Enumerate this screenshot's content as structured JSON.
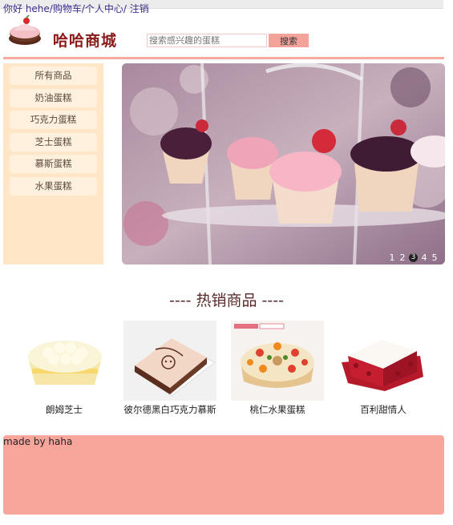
{
  "topnav": {
    "greeting": "你好 hehe",
    "cart": "购物车",
    "profile": "个人中心",
    "logout": "注销"
  },
  "brand": {
    "logo_text": "哈哈商城"
  },
  "search": {
    "placeholder": "搜索感兴趣的蛋糕",
    "button": "搜索"
  },
  "sidebar": {
    "items": [
      {
        "label": "所有商品"
      },
      {
        "label": "奶油蛋糕"
      },
      {
        "label": "巧克力蛋糕"
      },
      {
        "label": "芝士蛋糕"
      },
      {
        "label": "慕斯蛋糕"
      },
      {
        "label": "水果蛋糕"
      }
    ]
  },
  "carousel": {
    "indicators": [
      "1",
      "2",
      "3",
      "4",
      "5"
    ],
    "active_index": 3
  },
  "hot": {
    "title": "---- 热销商品 ----",
    "products": [
      {
        "name": "朗姆芝士"
      },
      {
        "name": "彼尔德黑白巧克力慕斯"
      },
      {
        "name": "桃仁水果蛋糕"
      },
      {
        "name": "百利甜情人"
      }
    ]
  },
  "footer": {
    "text": "made by haha"
  },
  "colors": {
    "accent": "#f8a59b",
    "sidebar_bg": "#ffe6c7",
    "brand": "#8b1a1a",
    "link": "#3a2f8f"
  }
}
